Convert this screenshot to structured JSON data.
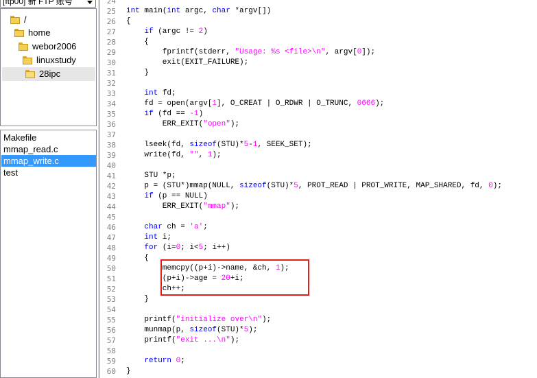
{
  "account_selector": {
    "label": "[ftp00] 新 FTP 账号"
  },
  "tree": {
    "items": [
      {
        "label": "/"
      },
      {
        "label": "home"
      },
      {
        "label": "webor2006"
      },
      {
        "label": "linuxstudy"
      },
      {
        "label": "28ipc"
      }
    ]
  },
  "files": {
    "items": [
      {
        "label": "Makefile"
      },
      {
        "label": "mmap_read.c"
      },
      {
        "label": "mmap_write.c"
      },
      {
        "label": "test"
      }
    ]
  },
  "editor": {
    "first_line_number": 24,
    "lines": [
      [
        {
          "t": ""
        }
      ],
      [
        {
          "t": "int",
          "c": "kw"
        },
        {
          "t": " main("
        },
        {
          "t": "int",
          "c": "kw"
        },
        {
          "t": " argc, "
        },
        {
          "t": "char",
          "c": "kw"
        },
        {
          "t": " *argv[])"
        }
      ],
      [
        {
          "t": "{"
        }
      ],
      [
        {
          "t": "    "
        },
        {
          "t": "if",
          "c": "kw"
        },
        {
          "t": " (argc != "
        },
        {
          "t": "2",
          "c": "num"
        },
        {
          "t": ")"
        }
      ],
      [
        {
          "t": "    {"
        }
      ],
      [
        {
          "t": "        fprintf(stderr, "
        },
        {
          "t": "\"Usage: %s <file>\\n\"",
          "c": "str"
        },
        {
          "t": ", argv["
        },
        {
          "t": "0",
          "c": "num"
        },
        {
          "t": "]);"
        }
      ],
      [
        {
          "t": "        exit(EXIT_FAILURE);"
        }
      ],
      [
        {
          "t": "    }"
        }
      ],
      [
        {
          "t": ""
        }
      ],
      [
        {
          "t": "    "
        },
        {
          "t": "int",
          "c": "kw"
        },
        {
          "t": " fd;"
        }
      ],
      [
        {
          "t": "    fd = open(argv["
        },
        {
          "t": "1",
          "c": "num"
        },
        {
          "t": "], O_CREAT | O_RDWR | O_TRUNC, "
        },
        {
          "t": "0666",
          "c": "num"
        },
        {
          "t": ");"
        }
      ],
      [
        {
          "t": "    "
        },
        {
          "t": "if",
          "c": "kw"
        },
        {
          "t": " (fd == "
        },
        {
          "t": "-1",
          "c": "num"
        },
        {
          "t": ")"
        }
      ],
      [
        {
          "t": "        ERR_EXIT("
        },
        {
          "t": "\"open\"",
          "c": "str"
        },
        {
          "t": ");"
        }
      ],
      [
        {
          "t": ""
        }
      ],
      [
        {
          "t": "    lseek(fd, "
        },
        {
          "t": "sizeof",
          "c": "kw"
        },
        {
          "t": "(STU)*"
        },
        {
          "t": "5",
          "c": "num"
        },
        {
          "t": "-"
        },
        {
          "t": "1",
          "c": "num"
        },
        {
          "t": ", SEEK_SET);"
        }
      ],
      [
        {
          "t": "    write(fd, "
        },
        {
          "t": "\"\"",
          "c": "str"
        },
        {
          "t": ", "
        },
        {
          "t": "1",
          "c": "num"
        },
        {
          "t": ");"
        }
      ],
      [
        {
          "t": ""
        }
      ],
      [
        {
          "t": "    STU *p;"
        }
      ],
      [
        {
          "t": "    p = (STU*)mmap(NULL, "
        },
        {
          "t": "sizeof",
          "c": "kw"
        },
        {
          "t": "(STU)*"
        },
        {
          "t": "5",
          "c": "num"
        },
        {
          "t": ", PROT_READ | PROT_WRITE, MAP_SHARED, fd, "
        },
        {
          "t": "0",
          "c": "num"
        },
        {
          "t": ");"
        }
      ],
      [
        {
          "t": "    "
        },
        {
          "t": "if",
          "c": "kw"
        },
        {
          "t": " (p == NULL)"
        }
      ],
      [
        {
          "t": "        ERR_EXIT("
        },
        {
          "t": "\"mmap\"",
          "c": "str"
        },
        {
          "t": ");"
        }
      ],
      [
        {
          "t": ""
        }
      ],
      [
        {
          "t": "    "
        },
        {
          "t": "char",
          "c": "kw"
        },
        {
          "t": " ch = "
        },
        {
          "t": "'a'",
          "c": "str"
        },
        {
          "t": ";"
        }
      ],
      [
        {
          "t": "    "
        },
        {
          "t": "int",
          "c": "kw"
        },
        {
          "t": " i;"
        }
      ],
      [
        {
          "t": "    "
        },
        {
          "t": "for",
          "c": "kw"
        },
        {
          "t": " (i="
        },
        {
          "t": "0",
          "c": "num"
        },
        {
          "t": "; i<"
        },
        {
          "t": "5",
          "c": "num"
        },
        {
          "t": "; i++)"
        }
      ],
      [
        {
          "t": "    {"
        }
      ],
      [
        {
          "t": "        memcpy((p+i)->name, &ch, "
        },
        {
          "t": "1",
          "c": "num"
        },
        {
          "t": ");"
        }
      ],
      [
        {
          "t": "        (p+i)->age = "
        },
        {
          "t": "20",
          "c": "num"
        },
        {
          "t": "+i;"
        }
      ],
      [
        {
          "t": "        ch++;"
        }
      ],
      [
        {
          "t": "    }"
        }
      ],
      [
        {
          "t": ""
        }
      ],
      [
        {
          "t": "    printf("
        },
        {
          "t": "\"initialize over\\n\"",
          "c": "str"
        },
        {
          "t": ");"
        }
      ],
      [
        {
          "t": "    munmap(p, "
        },
        {
          "t": "sizeof",
          "c": "kw"
        },
        {
          "t": "(STU)*"
        },
        {
          "t": "5",
          "c": "num"
        },
        {
          "t": ");"
        }
      ],
      [
        {
          "t": "    printf("
        },
        {
          "t": "\"exit ...\\n\"",
          "c": "str"
        },
        {
          "t": ");"
        }
      ],
      [
        {
          "t": ""
        }
      ],
      [
        {
          "t": "    "
        },
        {
          "t": "return",
          "c": "kw"
        },
        {
          "t": " "
        },
        {
          "t": "0",
          "c": "num"
        },
        {
          "t": ";"
        }
      ],
      [
        {
          "t": "}"
        }
      ]
    ],
    "highlight_lines": [
      50,
      52
    ],
    "colors": {
      "keyword": "#0000ff",
      "string": "#ff00ff",
      "line_number": "#808080",
      "highlight_border": "#e21b1b",
      "selection": "#3399ff"
    }
  }
}
